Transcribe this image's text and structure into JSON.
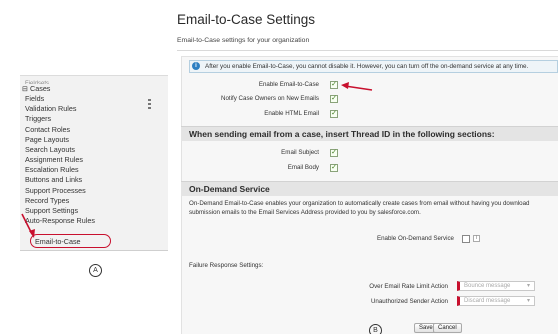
{
  "sidebar": {
    "clipped_item": "Fieldsets",
    "group_label": "Cases",
    "group_toggle": "⊟",
    "items": [
      {
        "label": "Fields"
      },
      {
        "label": "Validation Rules"
      },
      {
        "label": "Triggers"
      },
      {
        "label": "Contact Roles"
      },
      {
        "label": "Page Layouts"
      },
      {
        "label": "Search Layouts"
      },
      {
        "label": "Assignment Rules"
      },
      {
        "label": "Escalation Rules"
      },
      {
        "label": "Buttons and Links"
      },
      {
        "label": "Support Processes"
      },
      {
        "label": "Record Types"
      },
      {
        "label": "Support Settings"
      },
      {
        "label": "Auto-Response Rules"
      },
      {
        "label": "Email-to-Case"
      }
    ],
    "selected_item": "Email-to-Case",
    "marker_label": "A"
  },
  "page": {
    "title": "Email-to-Case Settings",
    "description": "Email-to-Case settings for your organization"
  },
  "info_banner": {
    "icon": "i",
    "text": "After you enable Email-to-Case, you cannot disable it. However, you can turn off the on-demand service at any time."
  },
  "general_settings": [
    {
      "label": "Enable Email-to-Case",
      "checked": true
    },
    {
      "label": "Notify Case Owners on New Emails",
      "checked": true
    },
    {
      "label": "Enable HTML Email",
      "checked": true
    }
  ],
  "thread_section": {
    "title": "When sending email from a case, insert Thread ID in the following sections:",
    "fields": [
      {
        "label": "Email Subject",
        "checked": true
      },
      {
        "label": "Email Body",
        "checked": true
      }
    ]
  },
  "on_demand": {
    "title": "On-Demand Service",
    "description_line1": "On-Demand Email-to-Case enables your organization to automatically create cases from email without having you download",
    "description_line2": "submission emails to the Email Services Address provided to you by salesforce.com.",
    "enable_label": "Enable On-Demand Service",
    "enable_checked": false,
    "help_icon": "i",
    "failure_label": "Failure Response Settings:",
    "over_limit_label": "Over Email Rate Limit Action",
    "over_limit_value": "Bounce message",
    "unauthorized_label": "Unauthorized Sender Action",
    "unauthorized_value": "Discard message",
    "select_chevron": "▾"
  },
  "buttons": {
    "save": "Save",
    "cancel": "Cancel"
  },
  "marker_b": "B",
  "colors": {
    "accent_red": "#c8102e",
    "info_blue": "#2d7fc2",
    "checkbox_green": "#3d7a1c"
  }
}
